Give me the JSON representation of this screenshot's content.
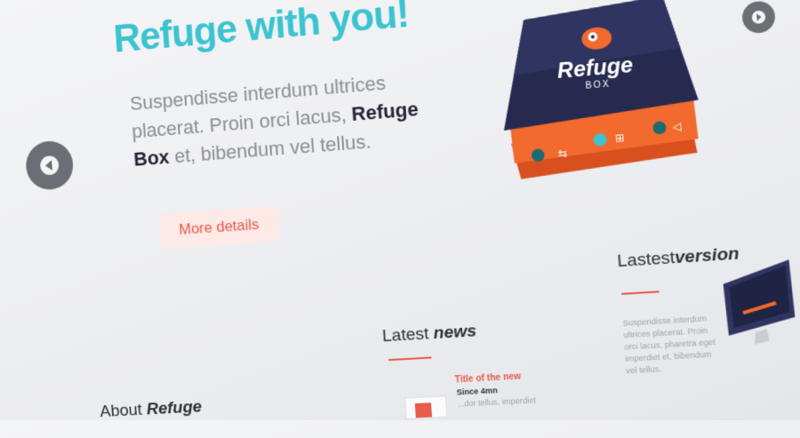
{
  "hero": {
    "title": "Refuge with you!",
    "description_start": "Suspendisse interdum ultrices placerat. Proin orci lacus, ",
    "description_bold": "Refuge Box",
    "description_end": " et, bibendum vel tellus.",
    "button_label": "More details"
  },
  "product": {
    "logo_text": "Refuge",
    "logo_sub": "BOX"
  },
  "sections": {
    "about": {
      "title_plain": "About ",
      "title_bold": "Refuge"
    },
    "news": {
      "title_plain": "Latest ",
      "title_bold": "news",
      "item": {
        "title": "Title of the new",
        "date": "Since 4mn",
        "text": "...dor tellus, imperdiet"
      }
    },
    "version": {
      "title_plain": "Lastest",
      "title_bold": "version",
      "text": "Suspendisse interdum ultrices placerat. Proin orci lacus, pharetra eget imperdiet et, bibendum vel tellus."
    }
  },
  "colors": {
    "accent": "#3cc3cf",
    "highlight": "#e65b4a",
    "dark": "#2a2238",
    "box_orange": "#f26a2e",
    "box_navy": "#262a4e"
  },
  "icons": [
    "chevron-left-icon",
    "chevron-right-icon",
    "usb-icon",
    "network-icon",
    "audio-icon",
    "monitor-icon"
  ]
}
